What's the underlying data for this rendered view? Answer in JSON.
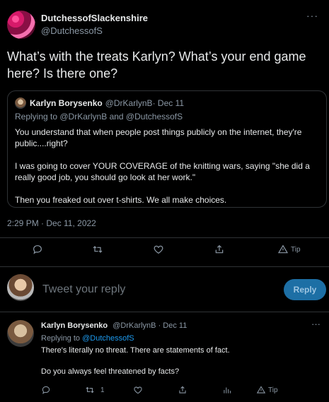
{
  "main_tweet": {
    "author_name": "DutchessofSlackenshire",
    "author_handle": "@DutchessofS",
    "more": "···",
    "text": "What’s with the treats Karlyn?  What’s your end game here?  Is there one?",
    "timestamp": "2:29 PM · Dec 11, 2022"
  },
  "quote": {
    "author_name": "Karlyn Borysenko",
    "author_handle": "@DrKarlynB",
    "date": " · Dec 11",
    "replying_prefix": "Replying to ",
    "replying_to": "@DrKarlynB and @DutchessofS",
    "paragraphs": [
      "You understand that when people post things publicly on the internet, they're public....right?",
      "I was going to cover YOUR COVERAGE of the knitting wars, saying \"she did a really good job, you should go look at her work.\"",
      "Then you freaked out over t-shirts. We all make choices."
    ]
  },
  "actions": {
    "reply_icon": "comment-icon",
    "retweet_icon": "retweet-icon",
    "like_icon": "heart-icon",
    "share_icon": "share-icon",
    "tip_label": "Tip"
  },
  "compose": {
    "placeholder": "Tweet your reply",
    "reply_button": "Reply"
  },
  "reply_tweet": {
    "author_name": "Karlyn Borysenko",
    "author_handle": "@DrKarlynB",
    "date": " · Dec 11",
    "more": "···",
    "replying_prefix": "Replying to ",
    "replying_to": "@DutchessofS",
    "paragraphs": [
      "There's literally no threat. There are statements of fact.",
      "Do you always feel threatened by facts?"
    ],
    "retweet_count": "1",
    "tip_label": "Tip"
  },
  "colors": {
    "background": "#000000",
    "text": "#e7e9ea",
    "muted": "#8b98a5",
    "accent": "#1d9bf0",
    "divider": "#2f3336",
    "reply_button_bg": "#1d6fa5"
  }
}
